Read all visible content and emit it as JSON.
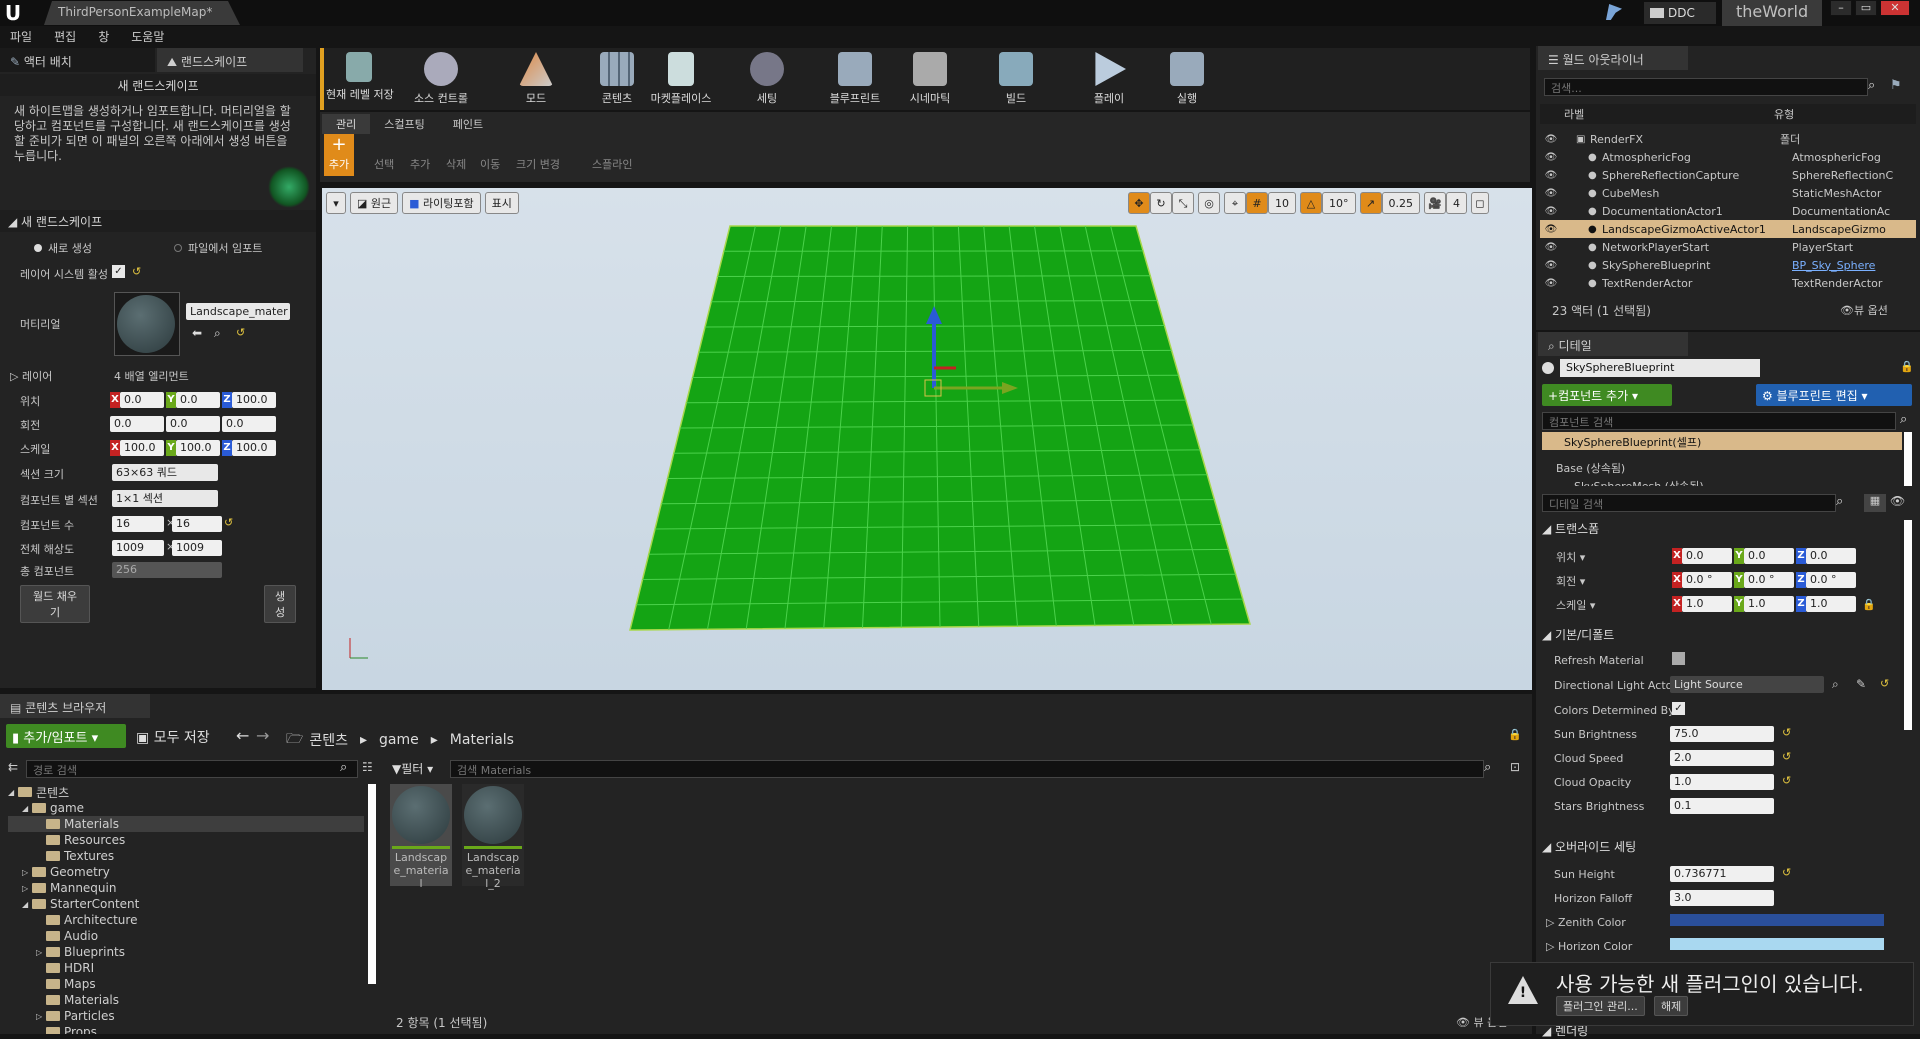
{
  "titlebar": {
    "tab": "ThirdPersonExampleMap*",
    "ddc": "DDC",
    "world": "theWorld",
    "min": "–",
    "max": "▭",
    "close": "✕"
  },
  "menu": [
    "파일",
    "편집",
    "창",
    "도움말"
  ],
  "leftTabs": {
    "place": "액터 배치",
    "landscape": "랜드스케이프"
  },
  "landscape": {
    "header": "새 랜드스케이프",
    "desc": "새 하이트맵을 생성하거나 임포트합니다. 머티리얼을 할당하고 컴포넌트를 구성합니다. 새 랜드스케이프를 생성할 준비가 되면 이 패널의 오른쪽 아래에서 생성 버튼을 누릅니다.",
    "section": "새 랜드스케이프",
    "radioNew": "새로 생성",
    "radioImport": "파일에서 임포트",
    "layerSystemLabel": "레이어 시스템 활성",
    "materialLabel": "머티리얼",
    "materialName": "Landscape_mater",
    "layerLabel": "레이어",
    "layerValue": "4 배열 엘리먼트",
    "locLabel": "위치",
    "loc": [
      "0.0",
      "0.0",
      "100.0"
    ],
    "rotLabel": "회전",
    "rot": [
      "0.0",
      "0.0",
      "0.0"
    ],
    "scaleLabel": "스케일",
    "scale": [
      "100.0",
      "100.0",
      "100.0"
    ],
    "sectionSizeLabel": "섹션 크기",
    "sectionSize": "63×63 쿼드",
    "sectionsPerCompLabel": "컴포넌트 별 섹션",
    "sectionsPerComp": "1×1 섹션",
    "compCountLabel": "컴포넌트 수",
    "compCount": [
      "16",
      "16"
    ],
    "resolutionLabel": "전체 해상도",
    "resolution": [
      "1009",
      "1009"
    ],
    "totalCompLabel": "총 컴포넌트",
    "totalComp": "256",
    "fillWorld": "월드 채우기",
    "create": "생성"
  },
  "toolbar": [
    "현재 레벨 저장",
    "소스 컨트롤",
    "모드",
    "콘텐츠",
    "마켓플레이스",
    "세팅",
    "블루프린트",
    "시네마틱",
    "빌드",
    "플레이",
    "실행"
  ],
  "modeTabs": [
    "관리",
    "스컬프팅",
    "페인트"
  ],
  "manageTools": [
    "추가",
    "선택",
    "추가",
    "삭제",
    "이동",
    "크기 변경",
    "스플라인"
  ],
  "viewport": {
    "perspective": "원근",
    "lit": "라이팅포함",
    "show": "표시",
    "grid": "10",
    "angle": "10°",
    "scale": "0.25",
    "speed": "4"
  },
  "outliner": {
    "title": "월드 아웃라이너",
    "search": "검색...",
    "colLabel": "라벨",
    "colType": "유형",
    "rows": [
      {
        "label": "RenderFX",
        "type": "폴더"
      },
      {
        "label": "AtmosphericFog",
        "type": "AtmosphericFog"
      },
      {
        "label": "SphereReflectionCapture",
        "type": "SphereReflectionC"
      },
      {
        "label": "CubeMesh",
        "type": "StaticMeshActor"
      },
      {
        "label": "DocumentationActor1",
        "type": "DocumentationAc"
      },
      {
        "label": "LandscapeGizmoActiveActor1",
        "type": "LandscapeGizmo"
      },
      {
        "label": "NetworkPlayerStart",
        "type": "PlayerStart"
      },
      {
        "label": "SkySphereBlueprint",
        "type": "BP_Sky_Sphere"
      },
      {
        "label": "TextRenderActor",
        "type": "TextRenderActor"
      }
    ],
    "count": "23 액터 (1 선택됨)",
    "viewOptions": "뷰 옵션"
  },
  "details": {
    "title": "디테일",
    "actorName": "SkySphereBlueprint",
    "addComponent": "컴포넌트 추가",
    "editBlueprint": "블루프린트 편집",
    "searchComponents": "컴포넌트 검색",
    "selfRow": "SkySphereBlueprint(셀프)",
    "baseRow": "Base (상속됨)",
    "meshRow": "SkySphereMesh (상속됨)",
    "searchDetails": "디테일 검색",
    "transform": "트랜스폼",
    "locLabel": "위치",
    "loc": [
      "0.0",
      "0.0",
      "0.0"
    ],
    "rotLabel": "회전",
    "rot": [
      "0.0 °",
      "0.0 °",
      "0.0 °"
    ],
    "scaleLabel": "스케일",
    "scale": [
      "1.0",
      "1.0",
      "1.0"
    ],
    "defaultSection": "기본/디폴트",
    "refreshMaterial": "Refresh Material",
    "dirLightActor": "Directional Light Actor",
    "dirLightValue": "Light Source",
    "colorsDetermined": "Colors Determined By",
    "sunBrightness": "Sun Brightness",
    "sunBrightnessV": "75.0",
    "cloudSpeed": "Cloud Speed",
    "cloudSpeedV": "2.0",
    "cloudOpacity": "Cloud Opacity",
    "cloudOpacityV": "1.0",
    "starsBrightness": "Stars Brightness",
    "starsBrightnessV": "0.1",
    "overrideSection": "오버라이드 세팅",
    "sunHeight": "Sun Height",
    "sunHeightV": "0.736771",
    "horizonFalloff": "Horizon Falloff",
    "horizonFalloffV": "3.0",
    "zenithColor": "Zenith Color",
    "horizonColor": "Horizon Color",
    "renderingSection": "렌더링"
  },
  "content": {
    "tab": "콘텐츠 브라우저",
    "addImport": "추가/임포트",
    "saveAll": "모두 저장",
    "crumbs": [
      "콘텐츠",
      "game",
      "Materials"
    ],
    "pathSearch": "경로 검색",
    "filter": "필터",
    "searchMaterials": "검색 Materials",
    "tree": [
      {
        "name": "콘텐츠",
        "d": 0
      },
      {
        "name": "game",
        "d": 1
      },
      {
        "name": "Materials",
        "d": 2
      },
      {
        "name": "Resources",
        "d": 2
      },
      {
        "name": "Textures",
        "d": 2
      },
      {
        "name": "Geometry",
        "d": 1
      },
      {
        "name": "Mannequin",
        "d": 1
      },
      {
        "name": "StarterContent",
        "d": 1
      },
      {
        "name": "Architecture",
        "d": 2
      },
      {
        "name": "Audio",
        "d": 2
      },
      {
        "name": "Blueprints",
        "d": 2
      },
      {
        "name": "HDRI",
        "d": 2
      },
      {
        "name": "Maps",
        "d": 2
      },
      {
        "name": "Materials",
        "d": 2
      },
      {
        "name": "Particles",
        "d": 2
      },
      {
        "name": "Props",
        "d": 2
      }
    ],
    "assets": [
      "Landscape_material",
      "Landscape_material_2"
    ],
    "itemCount": "2 항목 (1 선택됨)",
    "viewOptions": "뷰 옵션"
  },
  "notification": {
    "text": "사용 가능한 새 플러그인이 있습니다.",
    "manage": "플러그인 관리...",
    "dismiss": "해제"
  },
  "colors": {
    "accent": "#6aa81a",
    "selection": "#d9b98a",
    "zenith": "#2a4f9a",
    "horizon": "#a9d8f0",
    "ground": "#14a414"
  }
}
